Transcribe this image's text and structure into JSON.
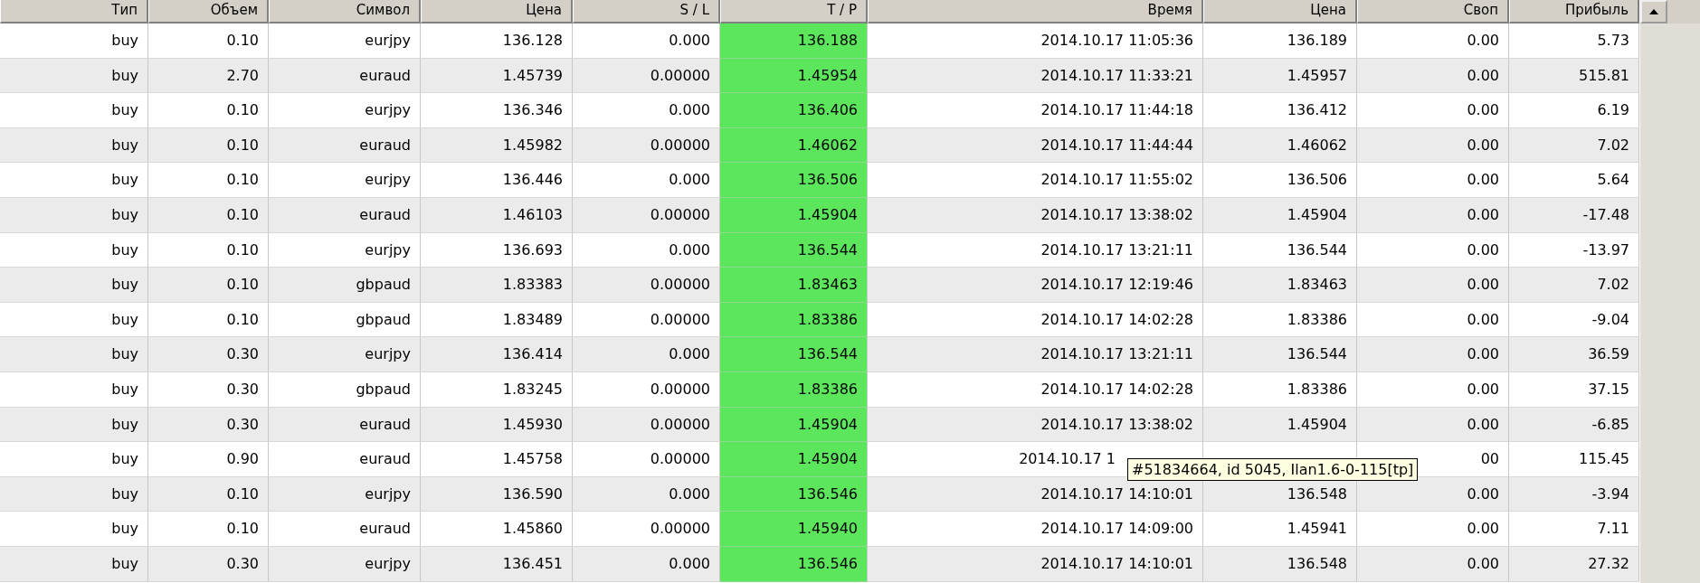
{
  "table": {
    "columns": [
      {
        "label": "Тип",
        "highlighted": false
      },
      {
        "label": "Объем",
        "highlighted": false
      },
      {
        "label": "Символ",
        "highlighted": false
      },
      {
        "label": "Цена",
        "highlighted": false
      },
      {
        "label": "S / L",
        "highlighted": false
      },
      {
        "label": "T / P",
        "highlighted": true
      },
      {
        "label": "Время",
        "highlighted": false
      },
      {
        "label": "Цена",
        "highlighted": false
      },
      {
        "label": "Своп",
        "highlighted": false
      },
      {
        "label": "Прибыль",
        "highlighted": false
      }
    ],
    "rows": [
      {
        "cells": [
          "buy",
          "0.10",
          "eurjpy",
          "136.128",
          "0.000",
          "136.188",
          "2014.10.17 11:05:36",
          "136.189",
          "0.00",
          "5.73"
        ]
      },
      {
        "cells": [
          "buy",
          "2.70",
          "euraud",
          "1.45739",
          "0.00000",
          "1.45954",
          "2014.10.17 11:33:21",
          "1.45957",
          "0.00",
          "515.81"
        ]
      },
      {
        "cells": [
          "buy",
          "0.10",
          "eurjpy",
          "136.346",
          "0.000",
          "136.406",
          "2014.10.17 11:44:18",
          "136.412",
          "0.00",
          "6.19"
        ]
      },
      {
        "cells": [
          "buy",
          "0.10",
          "euraud",
          "1.45982",
          "0.00000",
          "1.46062",
          "2014.10.17 11:44:44",
          "1.46062",
          "0.00",
          "7.02"
        ]
      },
      {
        "cells": [
          "buy",
          "0.10",
          "eurjpy",
          "136.446",
          "0.000",
          "136.506",
          "2014.10.17 11:55:02",
          "136.506",
          "0.00",
          "5.64"
        ]
      },
      {
        "cells": [
          "buy",
          "0.10",
          "euraud",
          "1.46103",
          "0.00000",
          "1.45904",
          "2014.10.17 13:38:02",
          "1.45904",
          "0.00",
          "-17.48"
        ]
      },
      {
        "cells": [
          "buy",
          "0.10",
          "eurjpy",
          "136.693",
          "0.000",
          "136.544",
          "2014.10.17 13:21:11",
          "136.544",
          "0.00",
          "-13.97"
        ]
      },
      {
        "cells": [
          "buy",
          "0.10",
          "gbpaud",
          "1.83383",
          "0.00000",
          "1.83463",
          "2014.10.17 12:19:46",
          "1.83463",
          "0.00",
          "7.02"
        ]
      },
      {
        "cells": [
          "buy",
          "0.10",
          "gbpaud",
          "1.83489",
          "0.00000",
          "1.83386",
          "2014.10.17 14:02:28",
          "1.83386",
          "0.00",
          "-9.04"
        ]
      },
      {
        "cells": [
          "buy",
          "0.30",
          "eurjpy",
          "136.414",
          "0.000",
          "136.544",
          "2014.10.17 13:21:11",
          "136.544",
          "0.00",
          "36.59"
        ]
      },
      {
        "cells": [
          "buy",
          "0.30",
          "gbpaud",
          "1.83245",
          "0.00000",
          "1.83386",
          "2014.10.17 14:02:28",
          "1.83386",
          "0.00",
          "37.15"
        ]
      },
      {
        "cells": [
          "buy",
          "0.30",
          "euraud",
          "1.45930",
          "0.00000",
          "1.45904",
          "2014.10.17 13:38:02",
          "1.45904",
          "0.00",
          "-6.85"
        ]
      },
      {
        "cells": [
          "buy",
          "0.90",
          "euraud",
          "1.45758",
          "0.00000",
          "1.45904",
          "2014.10.17 1",
          null,
          "00",
          "115.45"
        ],
        "tooltip": "#51834664, id 5045, Ilan1.6-0-115[tp]"
      },
      {
        "cells": [
          "buy",
          "0.10",
          "eurjpy",
          "136.590",
          "0.000",
          "136.546",
          "2014.10.17 14:10:01",
          "136.548",
          "0.00",
          "-3.94"
        ]
      },
      {
        "cells": [
          "buy",
          "0.10",
          "euraud",
          "1.45860",
          "0.00000",
          "1.45940",
          "2014.10.17 14:09:00",
          "1.45941",
          "0.00",
          "7.11"
        ]
      },
      {
        "cells": [
          "buy",
          "0.30",
          "eurjpy",
          "136.451",
          "0.000",
          "136.546",
          "2014.10.17 14:10:01",
          "136.548",
          "0.00",
          "27.32"
        ]
      }
    ]
  }
}
